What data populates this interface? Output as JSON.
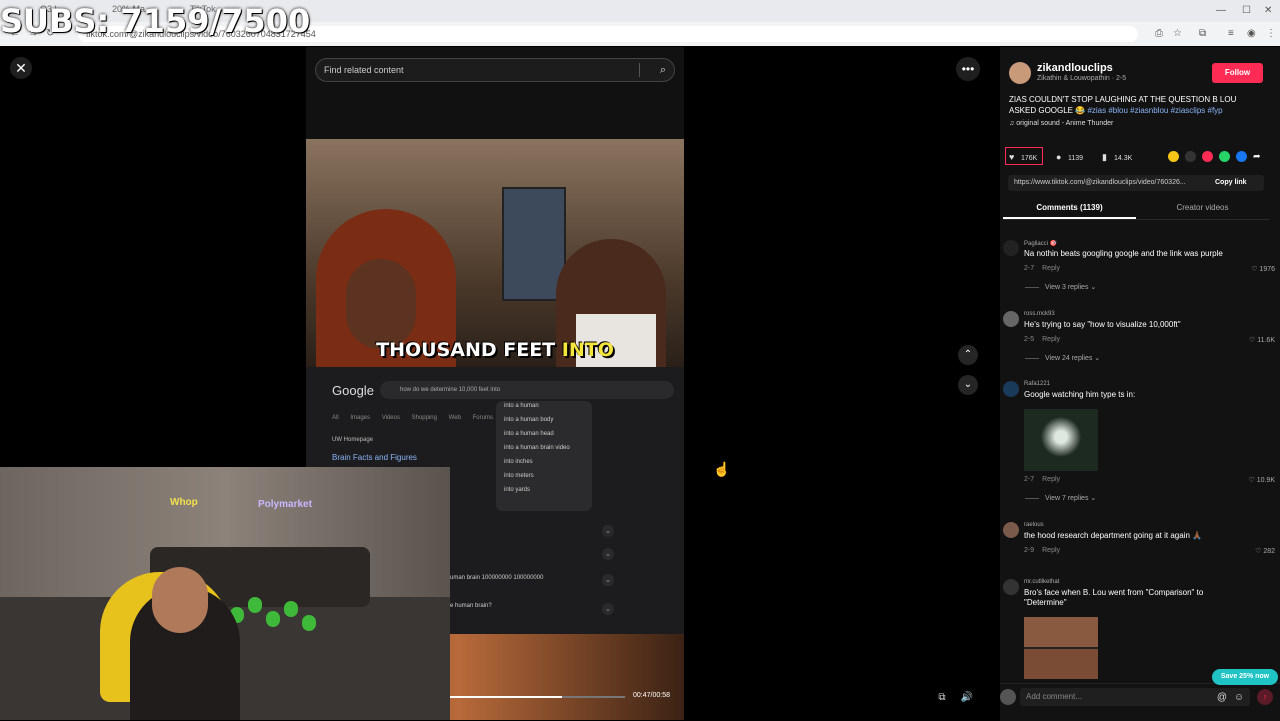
{
  "browser": {
    "tabs": [
      "Q3 | ...",
      "20% Ma...",
      "TikTok"
    ],
    "url": "tiktok.com/@zikandlouclips/video/7603260704831727454"
  },
  "overlay": {
    "subs_counter": "SUBS: 7159/7500"
  },
  "video": {
    "search_placeholder": "Find related content",
    "caption_part1": "THOUSAND FEET ",
    "caption_part2": "INTO",
    "google": {
      "logo": "Google",
      "query": "how do we determine 10,000 feet into",
      "tabs": [
        "All",
        "Images",
        "Videos",
        "Shopping",
        "Web",
        "Forums"
      ],
      "result_site": "UW Homepage",
      "result_title": "Brain Facts and Figures",
      "suggestions": [
        "into a human",
        "into a human body",
        "into a human head",
        "into a human brain video",
        "into inches",
        "into meters",
        "into yards"
      ],
      "snippet1": "uman brain 100000000 100000000",
      "snippet2": "e human brain?"
    },
    "time": "00:47/00:58",
    "progress_fraction": 0.64
  },
  "webcam": {
    "sign1": "Whop",
    "sign2": "Polymarket"
  },
  "post": {
    "username": "zikandlouclips",
    "nickname": "Zikathin & Louwopathin · 2-5",
    "follow_label": "Follow",
    "description": "ZIAS COULDN'T STOP LAUGHING AT THE QUESTION B LOU ASKED GOOGLE 😂 ",
    "hashtags": "#zias #blou #ziasnblou #ziasclips #fyp",
    "sound": "original sound - Anime Thunder",
    "likes": "176K",
    "comments": "1139",
    "saves": "14.3K",
    "link": "https://www.tiktok.com/@zikandlouclips/video/760326...",
    "copy_link": "Copy link",
    "tab_comments": "Comments (1139)",
    "tab_creator": "Creator videos"
  },
  "comments": [
    {
      "user": "Pagliacci 🎯",
      "text": "Na nothin beats googling google and the link was purple",
      "date": "2-7",
      "reply": "Reply",
      "likes": "1976",
      "replies": "View 3 replies"
    },
    {
      "user": "ross.mck93",
      "text": "He's trying to say \"how to visualize 10,000ft\"",
      "date": "2-5",
      "reply": "Reply",
      "likes": "11.6K",
      "replies": "View 24 replies"
    },
    {
      "user": "Rafa1221",
      "text": "Google watching him type ts in:",
      "date": "2-7",
      "reply": "Reply",
      "likes": "10.9K",
      "replies": "View 7 replies"
    },
    {
      "user": "raelous",
      "text": "the hood research department going at it again 🙏🏾",
      "date": "2-9",
      "reply": "Reply",
      "likes": "282"
    },
    {
      "user": "mr.cutlikethat",
      "text": "Bro's face when B. Lou went from \"Comparison\" to \"Determine\""
    }
  ],
  "composer": {
    "placeholder": "Add comment...",
    "save_badge": "Save 25% now"
  }
}
